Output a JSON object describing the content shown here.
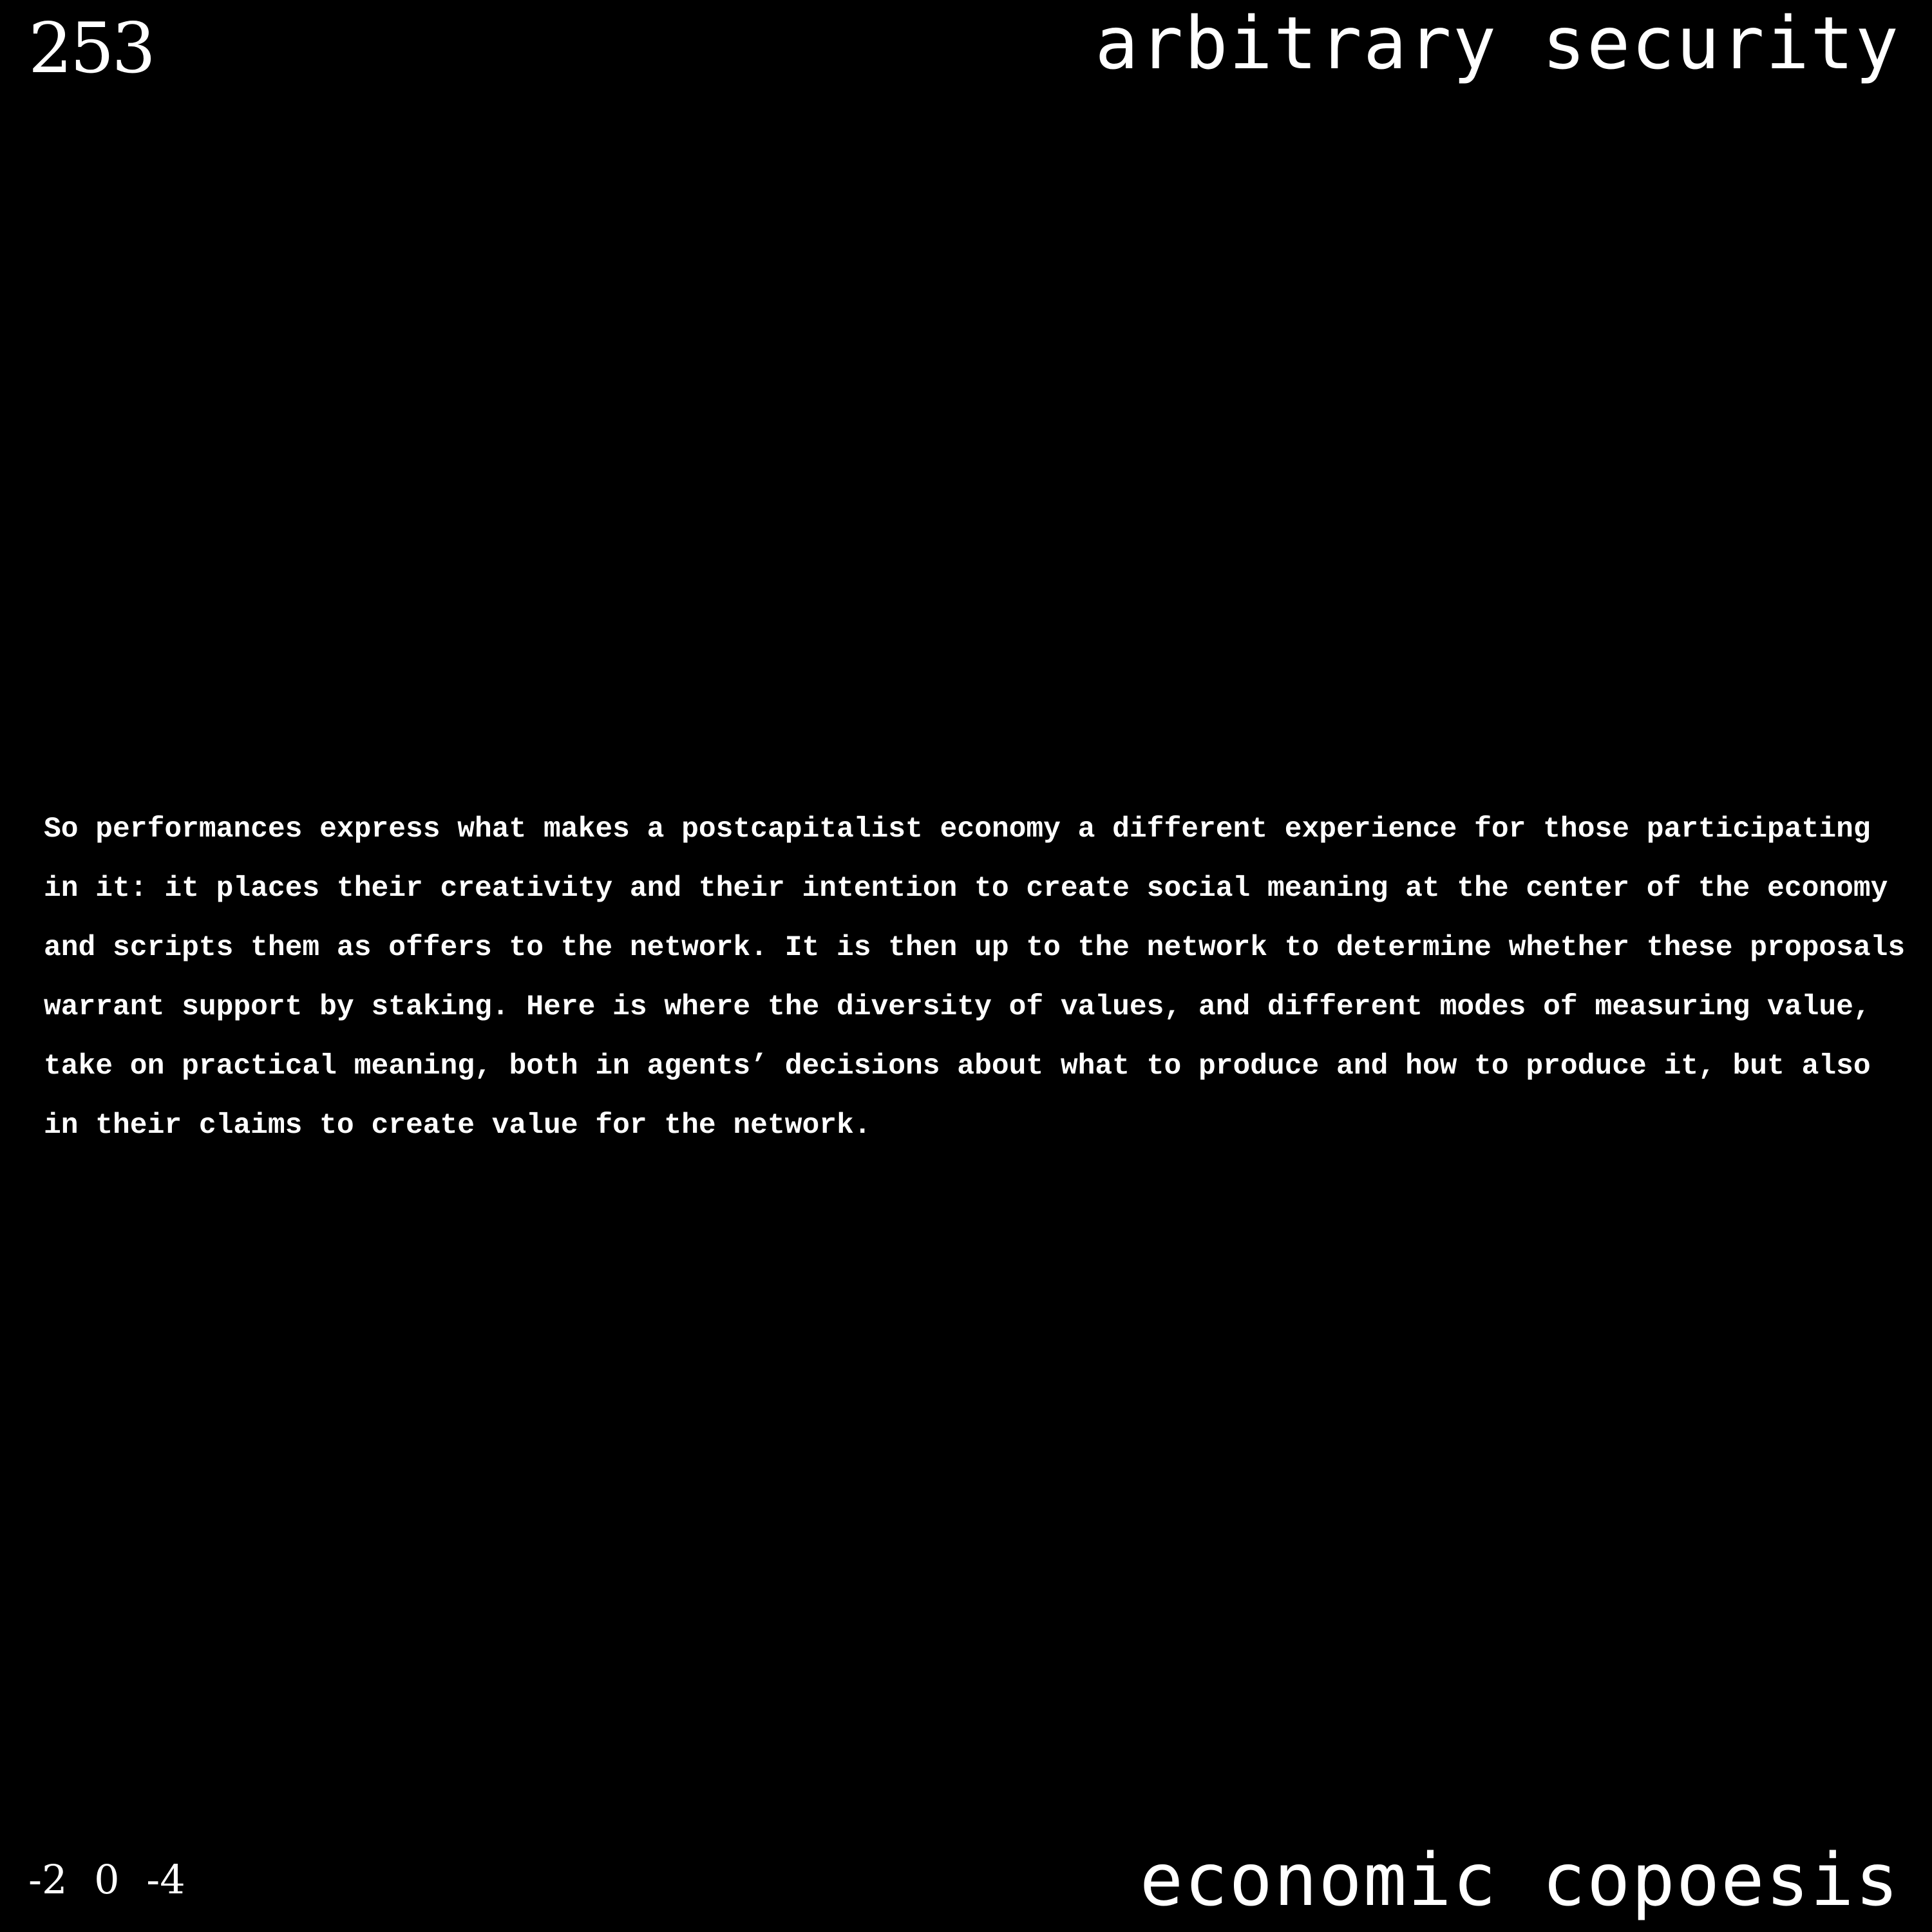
{
  "header": {
    "page_number": "253",
    "section_title": "arbitrary security"
  },
  "main": {
    "paragraph_lines": [
      "So performances express what makes a postcapitalist economy a different experience for those participating",
      "in it: it places their creativity and their intention to create social meaning at the center of the economy",
      "and scripts them as offers to the network. It is then up to the network to determine whether these proposals",
      "warrant support by staking. Here is where the diversity of values, and different modes of measuring value,",
      "take on practical meaning, both in agents’ decisions about what to produce and how to produce it, but also",
      "in their claims to create value for the network."
    ]
  },
  "footer": {
    "coordinates": "-2 0 -4",
    "title": "economic copoesis"
  },
  "colors": {
    "background": "#000000",
    "text": "#ffffff"
  }
}
